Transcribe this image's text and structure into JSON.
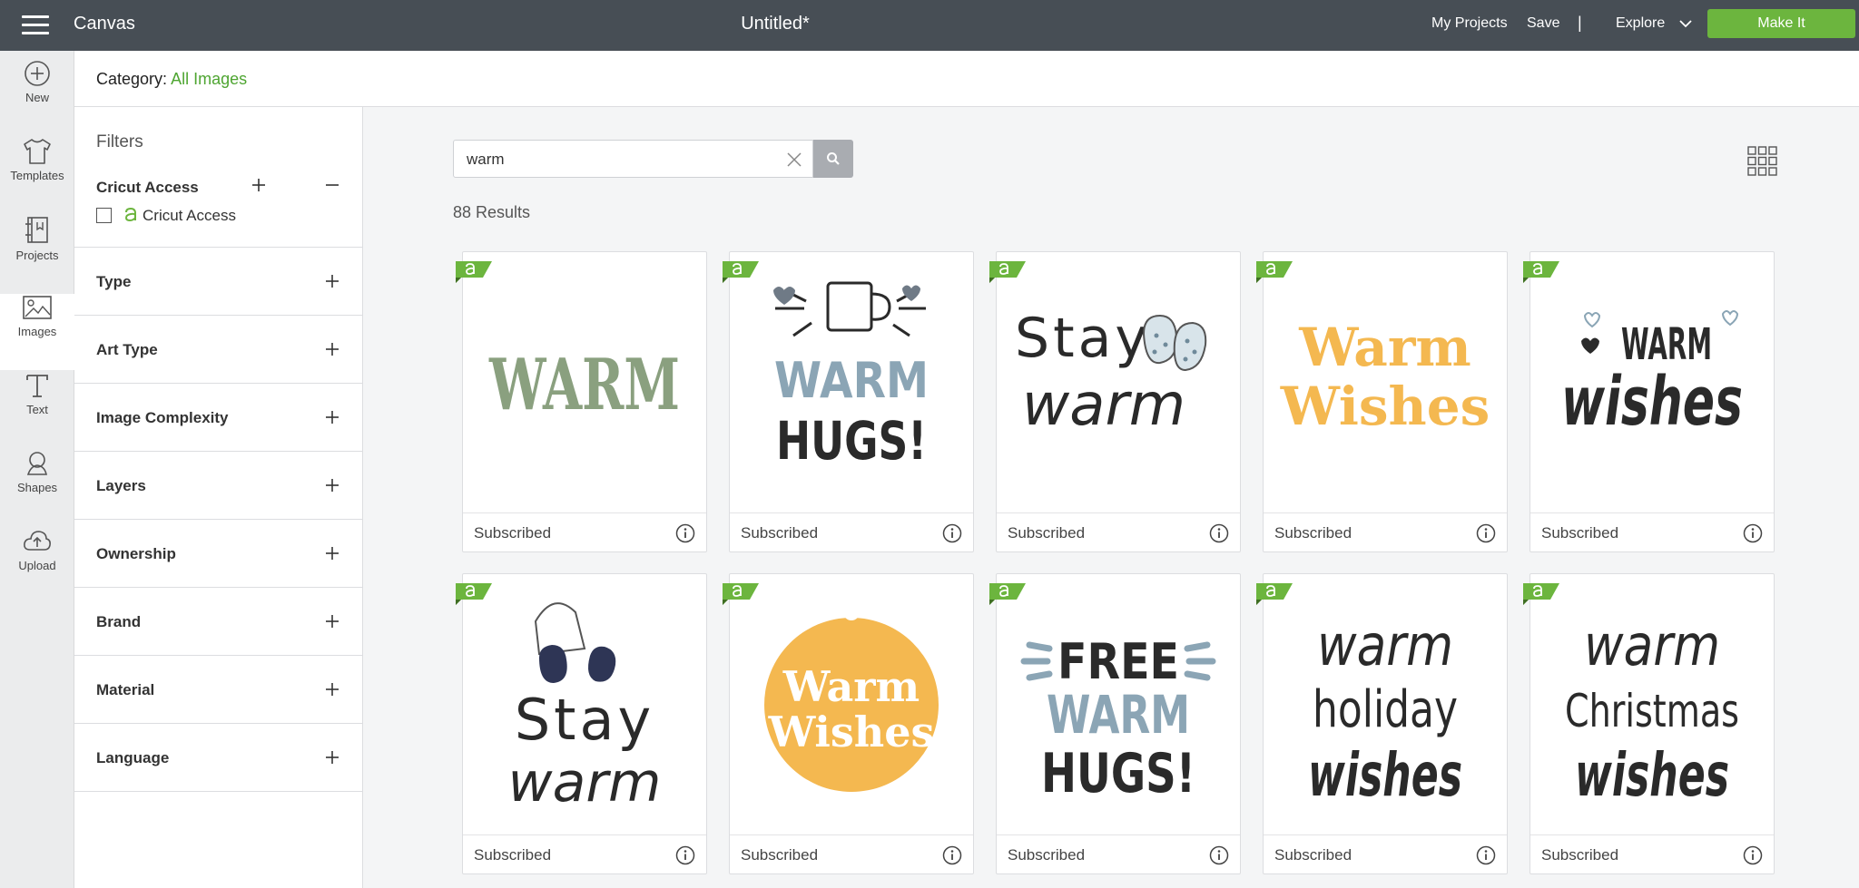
{
  "topbar": {
    "app_name": "Canvas",
    "doc_title": "Untitled*",
    "my_projects": "My Projects",
    "save": "Save",
    "separator": "|",
    "explore": "Explore",
    "make_it": "Make It",
    "make_it_color": "#6cb53e"
  },
  "rail": [
    {
      "label": "New",
      "icon": "plus-circle-icon"
    },
    {
      "label": "Templates",
      "icon": "tshirt-icon"
    },
    {
      "label": "Projects",
      "icon": "projects-icon"
    },
    {
      "label": "Images",
      "icon": "image-icon",
      "active": true
    },
    {
      "label": "Text",
      "icon": "text-icon"
    },
    {
      "label": "Shapes",
      "icon": "shapes-icon"
    },
    {
      "label": "Upload",
      "icon": "cloud-upload-icon"
    }
  ],
  "category": {
    "label": "Category:",
    "value": "All Images"
  },
  "filters": {
    "title": "Filters",
    "access_title": "Cricut Access",
    "access_option": "Cricut Access",
    "groups": [
      "Type",
      "Art Type",
      "Image Complexity",
      "Layers",
      "Ownership",
      "Brand",
      "Material",
      "Language"
    ]
  },
  "search": {
    "value": "warm",
    "results": "88 Results"
  },
  "cards": [
    {
      "status": "Subscribed",
      "art": [
        "WARM"
      ]
    },
    {
      "status": "Subscribed",
      "art": [
        "WARM",
        "HUGS!"
      ]
    },
    {
      "status": "Subscribed",
      "art": [
        "Stay",
        "warm"
      ]
    },
    {
      "status": "Subscribed",
      "art": [
        "Warm",
        "Wishes"
      ]
    },
    {
      "status": "Subscribed",
      "art": [
        "WARM",
        "wishes"
      ]
    },
    {
      "status": "Subscribed",
      "art": [
        "Stay",
        "warm"
      ]
    },
    {
      "status": "Subscribed",
      "art": [
        "Warm",
        "Wishes"
      ]
    },
    {
      "status": "Subscribed",
      "art": [
        "FREE",
        "WARM",
        "HUGS!"
      ]
    },
    {
      "status": "Subscribed",
      "art": [
        "warm",
        "holiday",
        "wishes"
      ]
    },
    {
      "status": "Subscribed",
      "art": [
        "warm",
        "Christmas",
        "wishes"
      ]
    }
  ],
  "colors": {
    "accent_green": "#6cb53e",
    "sage": "#8aa07f",
    "slate_blue": "#8ba5b5",
    "mustard": "#f4b850",
    "ink": "#2a2a2a",
    "navy": "#2e3555"
  }
}
